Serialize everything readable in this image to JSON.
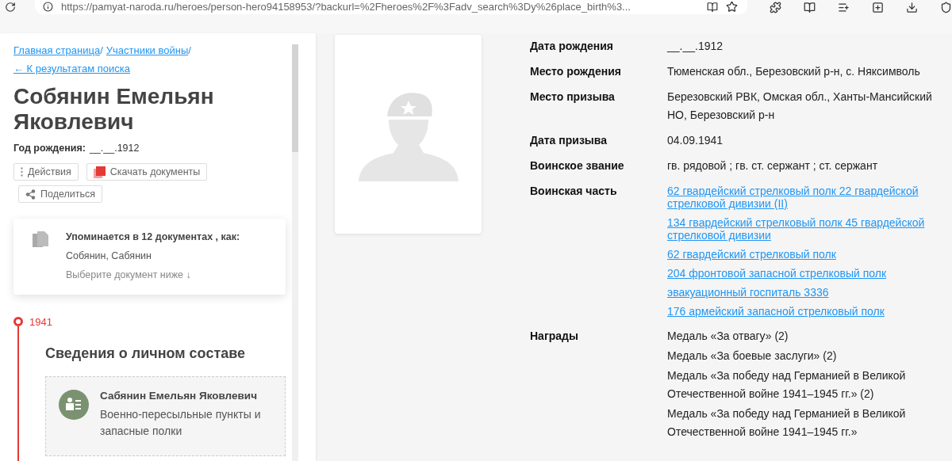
{
  "browser": {
    "url": "https://pamyat-naroda.ru/heroes/person-hero94158953/?backurl=%2Fheroes%2F%3Fadv_search%3Dy%26place_birth%3..."
  },
  "breadcrumbs": [
    {
      "label": "Главная страница",
      "separator": "/"
    },
    {
      "label": "Участники войны",
      "separator": "/"
    }
  ],
  "back_link": "← К результатам поиска",
  "person": {
    "name": "Собянин Емельян Яковлевич",
    "birth_label": "Год рождения:",
    "birth_value": "__.__.1912"
  },
  "actions": [
    {
      "kind": "dots",
      "label": "Действия"
    },
    {
      "kind": "pdf",
      "label": "Скачать документы"
    },
    {
      "kind": "share",
      "label": "Поделиться"
    }
  ],
  "mentions": {
    "title": "Упоминается в 12 документах , как:",
    "names": "Собянин, Сабянин",
    "hint": "Выберите документ ниже ↓"
  },
  "timeline": {
    "year": "1941",
    "section_title": "Сведения о личном составе",
    "record": {
      "name": "Сабянин Емельян Яковлевич",
      "category": "Военно-пересыльные пункты и запасные полки"
    }
  },
  "details": [
    {
      "label": "Дата рождения",
      "values": [
        {
          "kind": "text",
          "text": "__.__.1912"
        }
      ]
    },
    {
      "label": "Место рождения",
      "values": [
        {
          "kind": "text",
          "text": "Тюменская обл., Березовский р-н, с. Няксимволь"
        }
      ]
    },
    {
      "label": "Место призыва",
      "values": [
        {
          "kind": "text",
          "text": "Березовский РВК, Омская обл., Ханты-Мансийский НО, Березовский р-н"
        }
      ]
    },
    {
      "label": "Дата призыва",
      "values": [
        {
          "kind": "text",
          "text": "04.09.1941"
        }
      ]
    },
    {
      "label": "Воинское звание",
      "values": [
        {
          "kind": "text",
          "text": "гв. рядовой ; гв. ст. сержант ; ст. сержант"
        }
      ]
    },
    {
      "label": "Воинская часть",
      "values": [
        {
          "kind": "link",
          "text": "62 гвардейский стрелковый полк 22 гвардейской стрелковой дивизии (II)"
        },
        {
          "kind": "link",
          "text": "134 гвардейский стрелковый полк 45 гвардейской стрелковой дивизии"
        },
        {
          "kind": "link",
          "text": "62 гвардейский стрелковый полк"
        },
        {
          "kind": "link",
          "text": "204 фронтовой запасной стрелковый полк"
        },
        {
          "kind": "link",
          "text": "эвакуационный госпиталь 3336"
        },
        {
          "kind": "link",
          "text": "176 армейский запасной стрелковый полк"
        }
      ]
    },
    {
      "label": "Награды",
      "values": [
        {
          "kind": "text",
          "text": "Медаль «За отвагу» (2)"
        },
        {
          "kind": "text",
          "text": "Медаль «За боевые заслуги» (2)"
        },
        {
          "kind": "text",
          "text": "Медаль «За победу над Германией в Великой Отечественной войне 1941–1945 гг.» (2)"
        },
        {
          "kind": "text",
          "text": "Медаль «За победу над Германией в Великой Отечественной войне 1941–1945 гг.»"
        }
      ]
    }
  ]
}
